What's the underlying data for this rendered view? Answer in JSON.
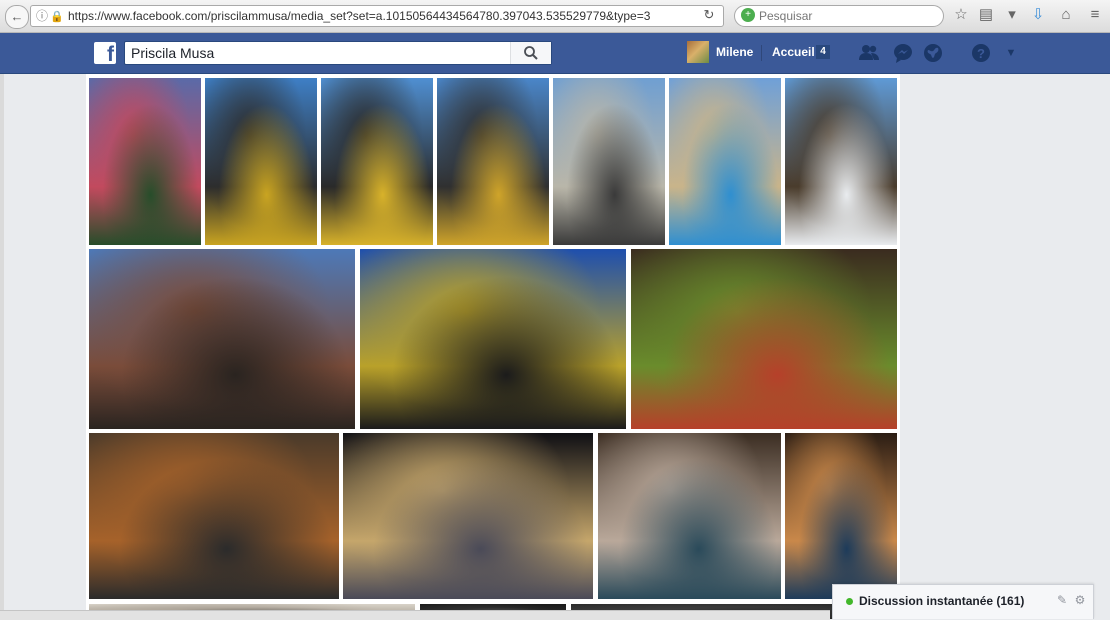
{
  "browser": {
    "url": "https://www.facebook.com/priscilammusa/media_set?set=a.10150564434564780.397043.535529779&type=3",
    "search_placeholder": "Pesquisar",
    "icons": [
      "back-icon",
      "info-icon",
      "lock-icon",
      "reload-icon",
      "bookmark-star-icon",
      "reading-list-icon",
      "pocket-icon",
      "download-icon",
      "home-icon",
      "menu-icon"
    ]
  },
  "facebook": {
    "search_value": "Priscila Musa",
    "profile_name": "Milene",
    "home_label": "Accueil",
    "home_count": "4",
    "icons": [
      "friend-requests-icon",
      "messages-icon",
      "notifications-globe-icon",
      "help-icon",
      "account-dropdown-icon"
    ]
  },
  "album": {
    "photos": [
      {
        "subject": "flower-offerings-statue",
        "c1": "#5a6aa8",
        "c2": "#c24a5e",
        "c3": "#274d2a"
      },
      {
        "subject": "statue-blue-sky",
        "c1": "#3e7fc6",
        "c2": "#2d2d2d",
        "c3": "#c9a421"
      },
      {
        "subject": "statue-crowd-yellow",
        "c1": "#4f8fd2",
        "c2": "#2a2a2a",
        "c3": "#d8b22a"
      },
      {
        "subject": "statue-crowd-dusk",
        "c1": "#4a86c9",
        "c2": "#303030",
        "c3": "#cfa42a"
      },
      {
        "subject": "fountain-building",
        "c1": "#6f9fd2",
        "c2": "#b9b6a9",
        "c3": "#3a3a3a"
      },
      {
        "subject": "palace-boat",
        "c1": "#6fa0d8",
        "c2": "#c9b48a",
        "c3": "#2f8fd0"
      },
      {
        "subject": "statue-boat-flowers",
        "c1": "#5f9ad6",
        "c2": "#4a3c2c",
        "c3": "#e9ecef"
      },
      {
        "subject": "plaza-dusk",
        "c1": "#4d79b8",
        "c2": "#7a4c3a",
        "c3": "#2a2420"
      },
      {
        "subject": "statue-night-crowd",
        "c1": "#1e4fae",
        "c2": "#b9a12a",
        "c3": "#1b1b1b"
      },
      {
        "subject": "altar-candles",
        "c1": "#3a2b1f",
        "c2": "#6a8c2c",
        "c3": "#b6402a"
      },
      {
        "subject": "altar-kneeling",
        "c1": "#4a3a2a",
        "c2": "#a6622a",
        "c3": "#2b2b2b"
      },
      {
        "subject": "palace-night",
        "c1": "#0f0f14",
        "c2": "#c5a66b",
        "c3": "#4a4a58"
      },
      {
        "subject": "women-candles",
        "c1": "#3b2d22",
        "c2": "#b9a89a",
        "c3": "#2a4a5a"
      },
      {
        "subject": "woman-candlelight",
        "c1": "#2b1d14",
        "c2": "#c9884a",
        "c3": "#1d3b5a"
      },
      {
        "subject": "bottom-row-1",
        "c1": "#d8d2c8",
        "c2": "#a59c90",
        "c3": "#4a4a4a"
      },
      {
        "subject": "bottom-row-2",
        "c1": "#1a1a1a",
        "c2": "#333333",
        "c3": "#6a6a6a"
      },
      {
        "subject": "bottom-row-3",
        "c1": "#2a2a2a",
        "c2": "#404040",
        "c3": "#151515"
      }
    ]
  },
  "chat": {
    "label": "Discussion instantanée (161)",
    "icons": [
      "compose-icon",
      "gear-icon"
    ]
  }
}
